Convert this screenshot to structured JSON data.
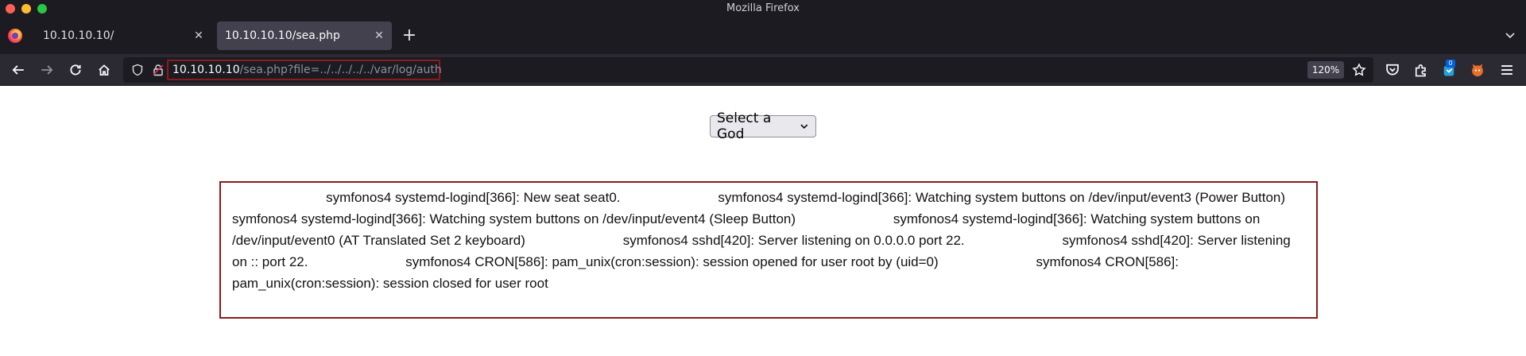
{
  "window": {
    "title": "Mozilla Firefox"
  },
  "tabs": [
    {
      "label": "10.10.10.10/",
      "active": false
    },
    {
      "label": "10.10.10.10/sea.php",
      "active": true
    }
  ],
  "toolbar": {
    "url_host": "10.10.10.10",
    "url_path": "/sea.php?file=../../../../../var/log/auth",
    "zoom": "120%",
    "notification_badge": "0"
  },
  "page": {
    "select_label": "Select a God",
    "log_lines": [
      "                         symfonos4 systemd-logind[366]: New seat seat0.",
      "                         symfonos4 systemd-logind[366]: Watching system buttons on /dev/input/event3 (Power Button)",
      "                         symfonos4 systemd-logind[366]: Watching system buttons on /dev/input/event4 (Sleep Button)",
      "                         symfonos4 systemd-logind[366]: Watching system buttons on /dev/input/event0 (AT Translated Set 2 keyboard)",
      "                         symfonos4 sshd[420]: Server listening on 0.0.0.0 port 22.",
      "                         symfonos4 sshd[420]: Server listening on :: port 22.",
      "                         symfonos4 CRON[586]: pam_unix(cron:session): session opened for user root by (uid=0)",
      "                         symfonos4 CRON[586]: pam_unix(cron:session): session closed for user root"
    ]
  },
  "colors": {
    "highlight_border": "#8b1a1a",
    "chrome_dark": "#1c1b22",
    "toolbar": "#2b2a33"
  }
}
